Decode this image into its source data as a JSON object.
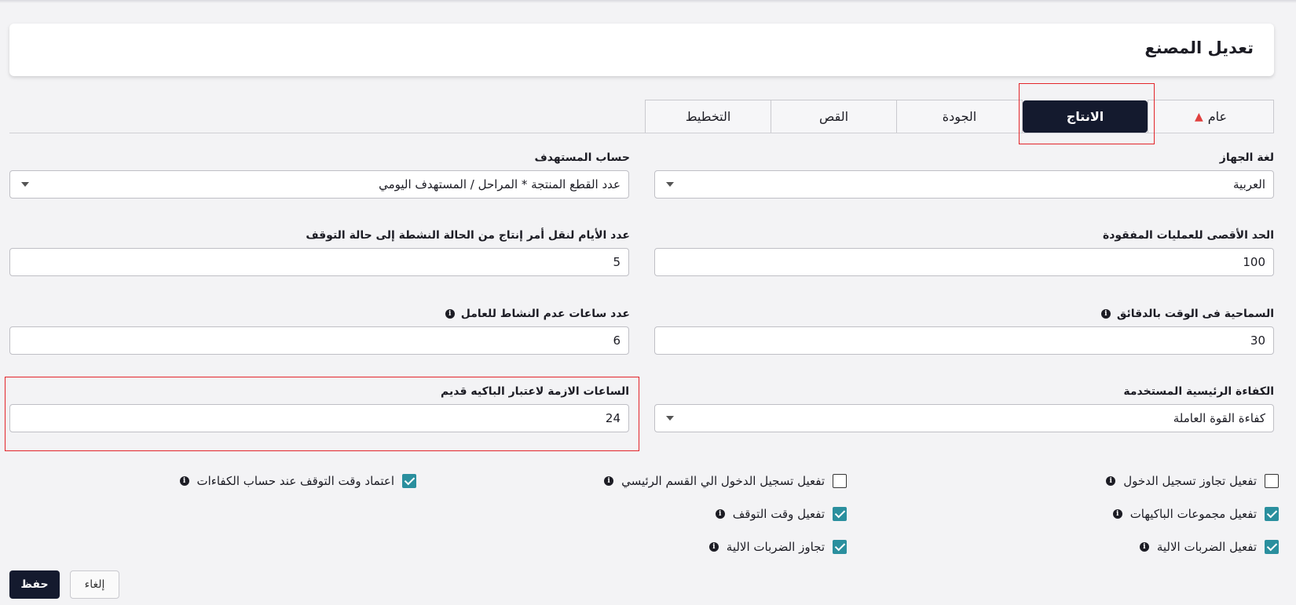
{
  "page": {
    "title": "تعديل المصنع"
  },
  "tabs": [
    {
      "label": "عام",
      "warning": true
    },
    {
      "label": "الانتاج",
      "active": true
    },
    {
      "label": "الجودة"
    },
    {
      "label": "القص"
    },
    {
      "label": "التخطيط"
    }
  ],
  "fields": {
    "device_language": {
      "label": "لغة الجهاز",
      "value": "العربية"
    },
    "target_calc": {
      "label": "حساب المستهدف",
      "value": "عدد القطع المنتجة * المراحل / المستهدف اليومي"
    },
    "max_lost_ops": {
      "label": "الحد الأقصى للعمليات المفقودة",
      "value": "100"
    },
    "days_to_stop": {
      "label": "عدد الأيام لنقل أمر إنتاج من الحالة النشطة إلى حالة التوقف",
      "value": "5"
    },
    "time_tolerance": {
      "label": "السماحية فى الوقت بالدقائق",
      "value": "30"
    },
    "idle_hours": {
      "label": "عدد ساعات عدم النشاط للعامل",
      "value": "6"
    },
    "main_efficiency": {
      "label": "الكفاءة الرئيسية المستخدمة",
      "value": "كفاءة القوة العاملة"
    },
    "old_bundle_hours": {
      "label": "الساعات الازمة لاعتبار الباكيه قديم",
      "value": "24"
    }
  },
  "checkboxes": {
    "login_override": {
      "label": "تفعيل تجاوز تسجيل الدخول",
      "checked": false
    },
    "main_section_login": {
      "label": "تفعيل تسجيل الدخول الي القسم الرئيسي",
      "checked": false
    },
    "downtime_efficiency": {
      "label": "اعتماد وقت التوقف عند حساب الكفاءات",
      "checked": true
    },
    "bundle_groups": {
      "label": "تفعيل مجموعات الباكيهات",
      "checked": true
    },
    "downtime": {
      "label": "تفعيل وقت التوقف",
      "checked": true
    },
    "auto_hits": {
      "label": "تفعيل الضربات الالية",
      "checked": true
    },
    "skip_auto_hits": {
      "label": "تجاوز الضربات الالية",
      "checked": true
    }
  },
  "buttons": {
    "save": "حفظ",
    "cancel": "إلغاء"
  },
  "icons": {
    "info": "info-icon",
    "warning": "warning-icon",
    "dropdown": "chevron-down-icon"
  }
}
